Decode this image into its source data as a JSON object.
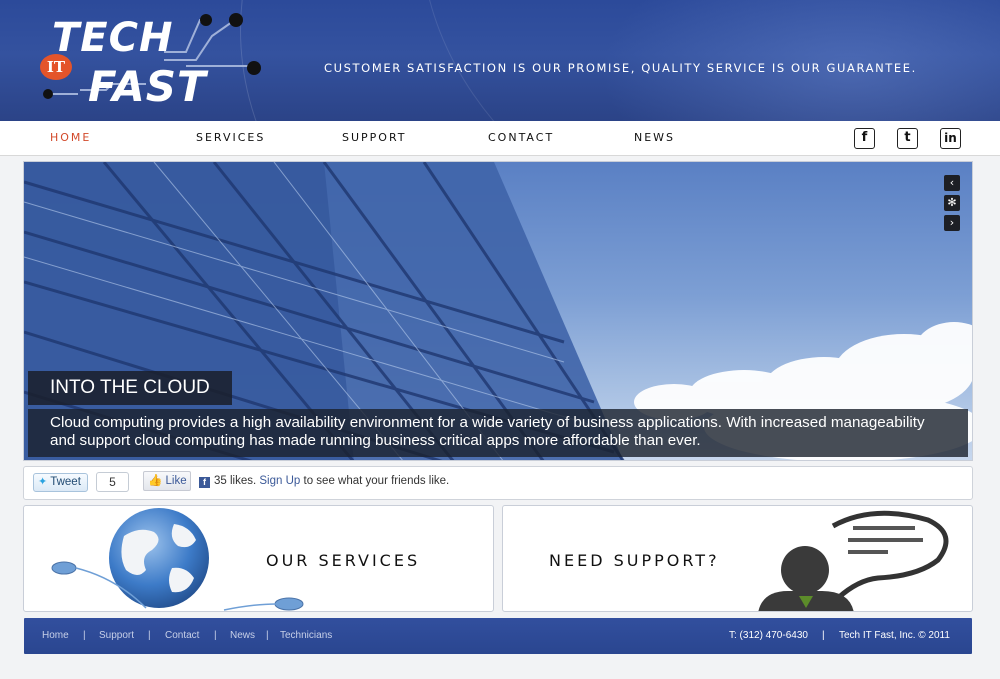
{
  "header": {
    "logo": {
      "tech": "TECH",
      "it": "IT",
      "fast": "FAST"
    },
    "tagline": "Customer satisfaction is our promise, Quality service is our guarantee."
  },
  "nav": {
    "items": [
      {
        "label": "Home",
        "active": true
      },
      {
        "label": "Services",
        "active": false
      },
      {
        "label": "Support",
        "active": false
      },
      {
        "label": "Contact",
        "active": false
      },
      {
        "label": "News",
        "active": false
      }
    ],
    "social": [
      {
        "icon": "facebook-icon",
        "glyph": "f"
      },
      {
        "icon": "twitter-icon",
        "glyph": "t"
      },
      {
        "icon": "linkedin-icon",
        "glyph": "in"
      }
    ]
  },
  "slider": {
    "title": "INTO THE CLOUD",
    "text": "Cloud computing provides a high availability environment for a wide variety of business applications. With increased manageability and support cloud computing has made running business critical apps more affordable than ever.",
    "controls": {
      "prev": "‹",
      "pause": "✻",
      "next": "›"
    }
  },
  "social_bar": {
    "tweet_label": "Tweet",
    "tweet_count": "5",
    "like_label": "Like",
    "likes_text": "35 likes.",
    "signup_label": "Sign Up",
    "likes_suffix": "to see what your friends like."
  },
  "boxes": {
    "services_title": "Our Services",
    "support_title": "Need Support?"
  },
  "footer": {
    "links": [
      "Home",
      "Support",
      "Contact",
      "News",
      "Technicians"
    ],
    "separator": "|",
    "phone": "T: (312) 470-6430",
    "copyright": "Tech IT Fast, Inc. © 2011"
  },
  "colors": {
    "brand_blue": "#2c4a9a",
    "accent_orange": "#d2492a"
  }
}
